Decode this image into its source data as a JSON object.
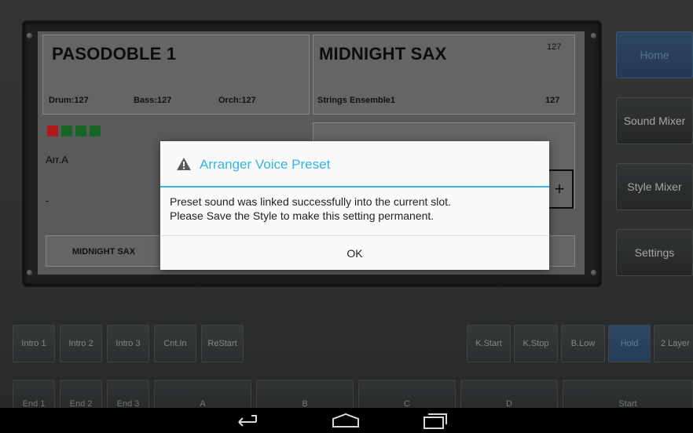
{
  "style_panel": {
    "title": "PASODOBLE 1",
    "drum": "Drum:127",
    "bass": "Bass:127",
    "orch": "Orch:127",
    "variation": "Arr.A",
    "dash": "-",
    "bottom_label": "MIDNIGHT SAX"
  },
  "voice_panel": {
    "title": "MIDNIGHT SAX",
    "volume": "127",
    "layer_name": "Strings Ensemble1",
    "layer_volume": "127",
    "plus_label": "+"
  },
  "leds": [
    "#d42020",
    "#1d7a2c",
    "#1d7a2c",
    "#1d7a2c"
  ],
  "side_menu": [
    {
      "label": "Home",
      "active": true
    },
    {
      "label": "Sound Mixer",
      "active": false
    },
    {
      "label": "Style Mixer",
      "active": false
    },
    {
      "label": "Settings",
      "active": false
    }
  ],
  "control_row": {
    "left": [
      "Intro 1",
      "Intro 2",
      "Intro 3",
      "Cnt.In",
      "ReStart"
    ],
    "right": [
      "K.Start",
      "K.Stop",
      "B.Low",
      "Hold",
      "2 Layer"
    ]
  },
  "bottom_row": [
    "End 1",
    "End 2",
    "End 3",
    "A",
    "B",
    "C",
    "D",
    "Start"
  ],
  "dialog": {
    "title": "Arranger Voice Preset",
    "line1": "Preset sound was linked successfully into the current slot.",
    "line2": "Please Save the Style to make this setting permanent.",
    "ok": "OK",
    "accent": "#33b5e5"
  },
  "nav": {
    "back": "back-icon",
    "home": "home-icon",
    "recents": "recents-icon"
  }
}
